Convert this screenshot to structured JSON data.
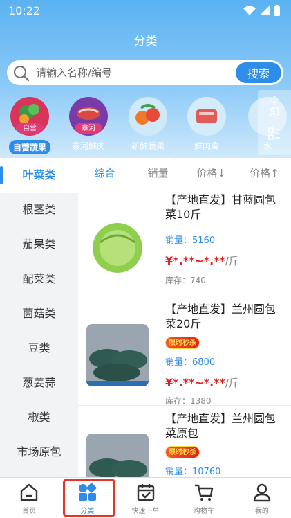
{
  "status": {
    "time": "10:22"
  },
  "header": {
    "title": "分类"
  },
  "search": {
    "placeholder": "请输入名称/编号",
    "button": "搜索"
  },
  "categories": [
    {
      "label": "自营蔬果",
      "badge": "自营",
      "active": true
    },
    {
      "label": "寨河鲜肉",
      "badge": "寨河"
    },
    {
      "label": "新鲜蔬果"
    },
    {
      "label": "鲜肉禽"
    },
    {
      "label": "水"
    }
  ],
  "all_button": {
    "line1": "全",
    "line2": "部"
  },
  "sidebar": {
    "items": [
      {
        "label": "叶菜类"
      },
      {
        "label": "根茎类"
      },
      {
        "label": "茄果类"
      },
      {
        "label": "配菜类"
      },
      {
        "label": "菌菇类"
      },
      {
        "label": "豆类"
      },
      {
        "label": "葱姜蒜"
      },
      {
        "label": "椒类"
      },
      {
        "label": "市场原包"
      }
    ]
  },
  "sort": {
    "comprehensive": "综合",
    "sales": "销量",
    "price_down": "价格↓",
    "price_up": "价格↑"
  },
  "products": [
    {
      "name": "【产地直发】甘蓝圆包菜10斤",
      "sales": "销量：5160",
      "price": "¥*.**~*.**",
      "unit": "/斤",
      "stock": "库存：740"
    },
    {
      "name": "【产地直发】兰州圆包菜20斤",
      "flash": "限时秒杀",
      "sales": "销量：6800",
      "price": "¥*.**~*.**",
      "unit": "/斤",
      "stock": "库存：1380"
    },
    {
      "name": "【产地直发】兰州圆包菜原包",
      "flash": "限时秒杀",
      "sales": "销量：10760"
    }
  ],
  "tabs": {
    "home": "首页",
    "category": "分类",
    "quick_order": "快速下单",
    "cart": "购物车",
    "mine": "我的"
  },
  "colors": {
    "accent": "#2e8de8",
    "price": "#e0201f",
    "highlight_outline": "#e8322c"
  }
}
